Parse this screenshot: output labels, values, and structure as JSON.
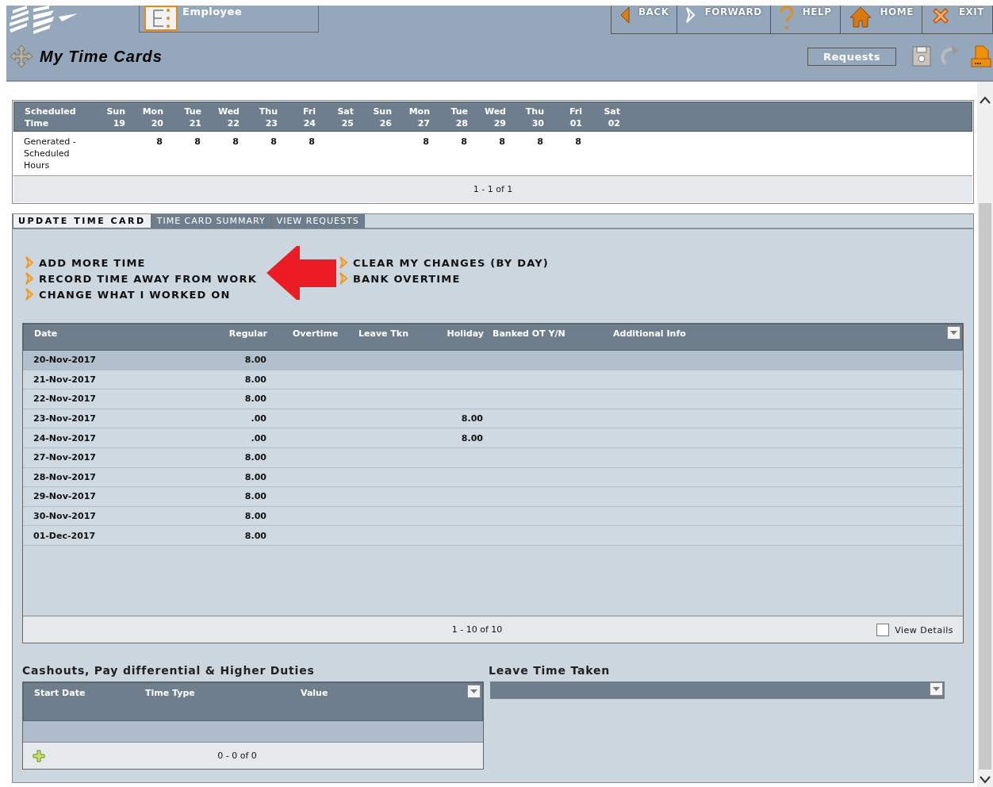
{
  "header": {
    "module_tab": "Employee",
    "nav": [
      {
        "label": "BACK",
        "kind": "back"
      },
      {
        "label": "FORWARD",
        "kind": "forward"
      },
      {
        "label": "HELP",
        "kind": "help"
      },
      {
        "label": "HOME",
        "kind": "home"
      },
      {
        "label": "EXIT",
        "kind": "exit"
      }
    ]
  },
  "page": {
    "title": "My Time Cards",
    "requests_button": "Requests"
  },
  "schedule": {
    "label_header": "Scheduled Time",
    "row_label": "Generated - Scheduled Hours",
    "days": [
      {
        "weekday": "Sun",
        "day": "19"
      },
      {
        "weekday": "Mon",
        "day": "20",
        "hours": "8"
      },
      {
        "weekday": "Tue",
        "day": "21",
        "hours": "8"
      },
      {
        "weekday": "Wed",
        "day": "22",
        "hours": "8"
      },
      {
        "weekday": "Thu",
        "day": "23",
        "hours": "8"
      },
      {
        "weekday": "Fri",
        "day": "24",
        "hours": "8"
      },
      {
        "weekday": "Sat",
        "day": "25"
      },
      {
        "weekday": "Sun",
        "day": "26"
      },
      {
        "weekday": "Mon",
        "day": "27",
        "hours": "8"
      },
      {
        "weekday": "Tue",
        "day": "28",
        "hours": "8"
      },
      {
        "weekday": "Wed",
        "day": "29",
        "hours": "8"
      },
      {
        "weekday": "Thu",
        "day": "30",
        "hours": "8"
      },
      {
        "weekday": "Fri",
        "day": "01",
        "hours": "8"
      },
      {
        "weekday": "Sat",
        "day": "02"
      }
    ],
    "pager": "1 - 1 of 1"
  },
  "tabs": [
    {
      "label": "UPDATE TIME CARD",
      "selected": true
    },
    {
      "label": "TIME CARD SUMMARY",
      "selected": false
    },
    {
      "label": "VIEW REQUESTS",
      "selected": false
    }
  ],
  "actions": {
    "left": [
      "ADD MORE TIME",
      "RECORD TIME AWAY FROM WORK",
      "CHANGE WHAT I WORKED ON"
    ],
    "right": [
      "CLEAR MY CHANGES (BY DAY)",
      "BANK OVERTIME"
    ]
  },
  "time_grid": {
    "columns": [
      "Date",
      "Regular",
      "Overtime",
      "Leave Tkn",
      "Holiday",
      "Banked OT Y/N",
      "Additional Info"
    ],
    "rows": [
      {
        "date": "20-Nov-2017",
        "regular": "8.00",
        "selected": true
      },
      {
        "date": "21-Nov-2017",
        "regular": "8.00",
        "selected": false
      },
      {
        "date": "22-Nov-2017",
        "regular": "8.00",
        "selected": false
      },
      {
        "date": "23-Nov-2017",
        "regular": ".00",
        "holiday": "8.00",
        "selected": false
      },
      {
        "date": "24-Nov-2017",
        "regular": ".00",
        "holiday": "8.00",
        "selected": false
      },
      {
        "date": "27-Nov-2017",
        "regular": "8.00",
        "selected": false
      },
      {
        "date": "28-Nov-2017",
        "regular": "8.00",
        "selected": false
      },
      {
        "date": "29-Nov-2017",
        "regular": "8.00",
        "selected": false
      },
      {
        "date": "30-Nov-2017",
        "regular": "8.00",
        "selected": false
      },
      {
        "date": "01-Dec-2017",
        "regular": "8.00",
        "selected": false
      }
    ],
    "pager": "1 - 10 of 10",
    "view_details": {
      "label": "View Details",
      "checked": false
    }
  },
  "cashouts": {
    "title": "Cashouts, Pay differential & Higher Duties",
    "columns": [
      "Start Date",
      "Time Type",
      "Value"
    ],
    "pager": "0 - 0 of 0"
  },
  "leave_taken": {
    "title": "Leave Time Taken"
  }
}
